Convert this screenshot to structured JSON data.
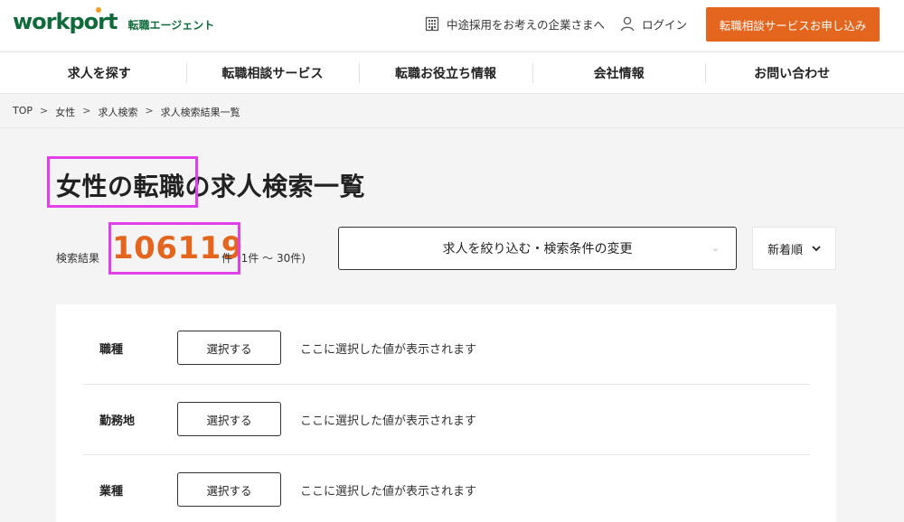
{
  "header": {
    "logo_text": "workport",
    "logo_sub": "転職エージェント",
    "corp_link": "中途採用をお考えの企業さまへ",
    "login": "ログイン",
    "cta": "転職相談サービスお申し込み"
  },
  "nav": {
    "items": [
      {
        "label": "求人を探す"
      },
      {
        "label": "転職相談サービス"
      },
      {
        "label": "転職お役立ち情報"
      },
      {
        "label": "会社情報"
      },
      {
        "label": "お問い合わせ"
      }
    ]
  },
  "breadcrumb": {
    "items": [
      "TOP",
      "女性",
      "求人検索",
      "求人検索結果一覧"
    ],
    "separator": ">"
  },
  "page": {
    "title": "女性の転職の求人検索一覧",
    "result_label": "検索結果",
    "result_count": "106119",
    "result_unit": "件",
    "result_range": "(1件 〜 30件)",
    "filter_button": "求人を絞り込む・検索条件の変更",
    "sort_value": "新着順"
  },
  "filters": {
    "rows": [
      {
        "label": "職種",
        "button": "選択する",
        "value": "ここに選択した値が表示されます"
      },
      {
        "label": "勤務地",
        "button": "選択する",
        "value": "ここに選択した値が表示されます"
      },
      {
        "label": "業種",
        "button": "選択する",
        "value": "ここに選択した値が表示されます"
      }
    ]
  },
  "colors": {
    "brand_green": "#0f6b3a",
    "accent_orange": "#e4651d",
    "highlight_magenta": "#e040e8"
  },
  "icons": {
    "corp": "building-icon",
    "login": "user-icon",
    "sort": "chevron-down-icon",
    "filter": "chevron-down-icon"
  }
}
